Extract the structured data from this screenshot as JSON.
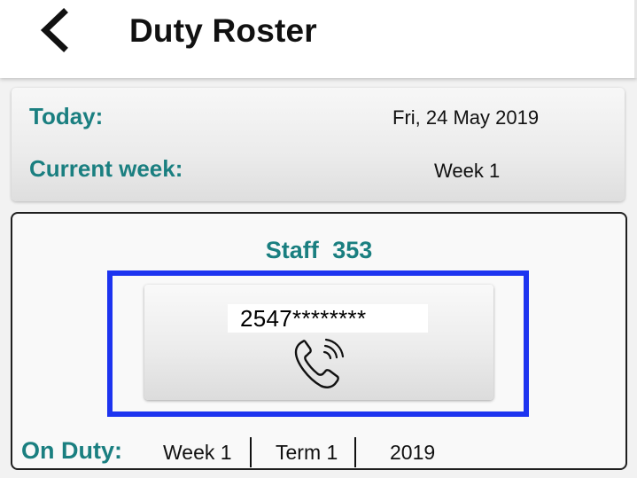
{
  "header": {
    "title": "Duty Roster",
    "back_icon": "chevron-left-icon"
  },
  "summary": {
    "today_label": "Today:",
    "today_value": "Fri, 24 May 2019",
    "week_label": "Current week:",
    "week_value": "Week 1"
  },
  "staff": {
    "label": "Staff",
    "number": "353",
    "phone": "2547********",
    "call_icon": "phone-call-icon",
    "on_duty_label": "On Duty:",
    "on_duty": {
      "week": "Week 1",
      "term": "Term 1",
      "year": "2019"
    }
  },
  "colors": {
    "accent": "#1a7f80",
    "highlight": "#1d34f0"
  }
}
